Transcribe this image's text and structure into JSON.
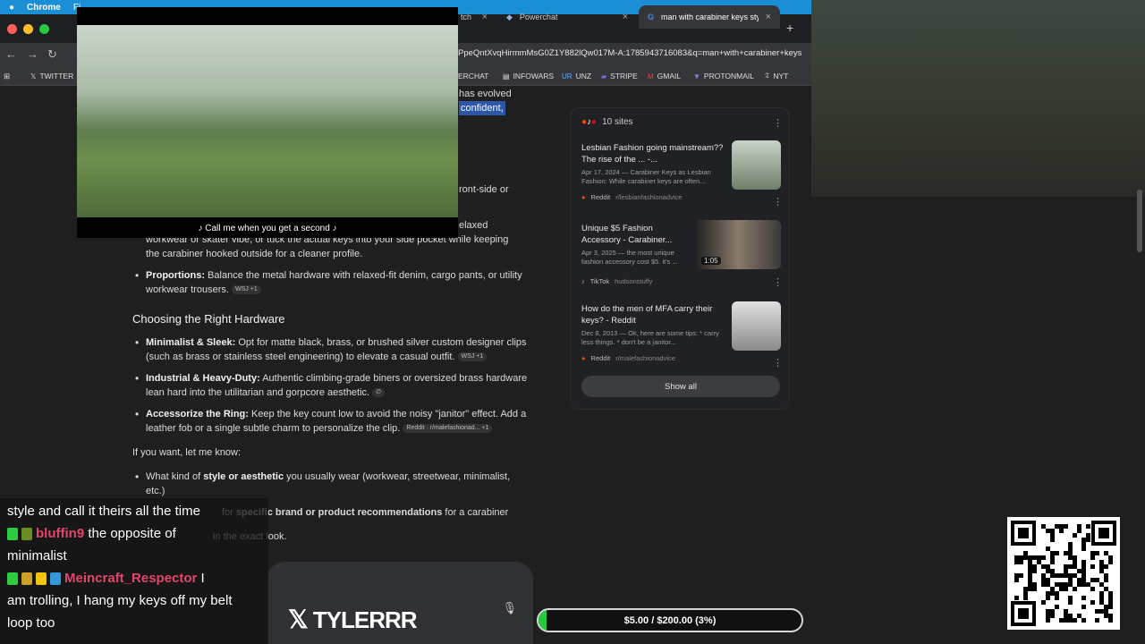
{
  "macbar": {
    "app": "Chrome",
    "menu_first": "Fi"
  },
  "tabs": [
    {
      "label": "tch",
      "close": "×"
    },
    {
      "label": "Powerchat",
      "close": "×"
    },
    {
      "label": "man with carabiner keys style",
      "close": "×"
    }
  ],
  "newtab": "+",
  "url": "PpeQntXvqHirmmMsG0Z1Y882lQw017M-A:1785943716083&q=man+with+carabiner+keys",
  "bookmarks": [
    {
      "label": "TWITTER",
      "icon": "x-logo-icon"
    },
    {
      "label": "ERCHAT",
      "icon": ""
    },
    {
      "label": "INFOWARS",
      "icon": "infowars-icon"
    },
    {
      "label": "UNZ",
      "icon": "unz-icon"
    },
    {
      "label": "STRIPE",
      "icon": "stripe-icon"
    },
    {
      "label": "GMAIL",
      "icon": "gmail-icon"
    },
    {
      "label": "PROTONMAIL",
      "icon": "protonmail-icon"
    },
    {
      "label": "NYT",
      "icon": "nyt-icon"
    }
  ],
  "answer": {
    "frag_evolved": "has evolved",
    "frag_confident": "confident,",
    "frag_frontside": "ront-side or",
    "frag_relaxed": "elaxed",
    "workwear_line1": "workwear or skater vibe, or tuck the actual keys into your side pocket while keeping",
    "workwear_line2": "the carabiner hooked outside for a cleaner profile.",
    "proportions_label": "Proportions:",
    "proportions_text": " Balance the metal hardware with relaxed-fit denim, cargo pants, or utility workwear trousers.",
    "proportions_cite": "WSJ +1",
    "heading": "Choosing the Right Hardware",
    "minimal_label": "Minimalist & Sleek:",
    "minimal_text": " Opt for matte black, brass, or brushed silver custom designer clips (such as brass or stainless steel engineering) to elevate a casual outfit.",
    "minimal_cite": "WSJ +1",
    "industrial_label": "Industrial & Heavy-Duty:",
    "industrial_text": " Authentic climbing-grade biners or oversized brass hardware lean hard into the utilitarian and gorpcore aesthetic.",
    "accessorize_label": "Accessorize the Ring:",
    "accessorize_text": " Keep the key count low to avoid the noisy \"janitor\" effect. Add a leather fob or a single subtle charm to personalize the clip.",
    "accessorize_cite": "Reddit · r/malefashionad... +1",
    "letmeknow": "If you want, let me know:",
    "q1_pre": "What kind of ",
    "q1_bold": "style or aesthetic",
    "q1_post": " you usually wear (workwear, streetwear, minimalist, etc.)",
    "q2_pre": "for ",
    "q2_bold": "specific brand or product recommendations",
    "q2_post": " for a carabiner",
    "q3": "in the exact look."
  },
  "sources": {
    "count_label": "10 sites",
    "items": [
      {
        "title": "Lesbian Fashion going mainstream?? The rise of the ... -...",
        "desc": "Apr 17, 2024 — Carabiner Keys as Lesbian Fashion: While carabiner keys are often...",
        "site": "Reddit",
        "sub": "r/lesbianfashionadvice"
      },
      {
        "title": "Unique $5 Fashion Accessory - Carabiner...",
        "desc": "Apr 3, 2025 — the most unique fashion accessory cost $5. it's ...",
        "site": "TikTok",
        "sub": "hudsonstuffy",
        "duration": "1:05"
      },
      {
        "title": "How do the men of MFA carry their keys? - Reddit",
        "desc": "Dec 8, 2013 — Ok, here are some tips: * carry less things. * don't be a janitor...",
        "site": "Reddit",
        "sub": "r/malefashionadvice"
      }
    ],
    "show_all": "Show all"
  },
  "video": {
    "caption": "♪ Call me when you get a second ♪"
  },
  "chat": {
    "line1": "style and call it theirs all the time",
    "user1": "bluffin9",
    "msg1a": " the opposite of",
    "msg1b": "minimalist",
    "user2": "Meincraft_Respector",
    "msg2a": " I",
    "msg2b": "am trolling, I hang my keys off my belt",
    "msg2c": "loop too"
  },
  "brand": {
    "name": "TYLERRR"
  },
  "goal": {
    "text": "$5.00 / $200.00 (3%)",
    "progress": 0.03,
    "color": "#27c93f"
  },
  "colors": {
    "accent": "#1a8fd6",
    "highlight": "#2d55a8",
    "chat_name": "#e2456b"
  }
}
